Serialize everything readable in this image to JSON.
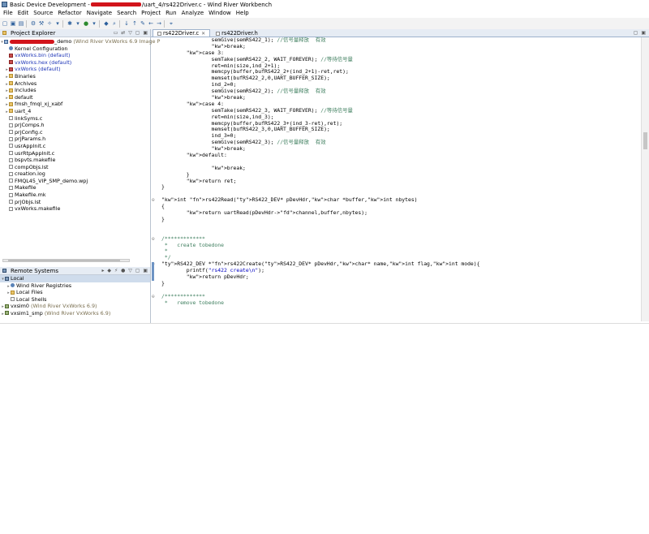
{
  "window": {
    "title_prefix": "Basic Device Development - ",
    "title_suffix": "/uart_4/rs422Driver.c - Wind River Workbench"
  },
  "menu": [
    "File",
    "Edit",
    "Source",
    "Refactor",
    "Navigate",
    "Search",
    "Project",
    "Run",
    "Analyze",
    "Window",
    "Help"
  ],
  "project_explorer": {
    "title": "Project Explorer",
    "project_name_suffix": "_demo",
    "project_suffix": "(Wind River VxWorks 6.9 Image P",
    "items": [
      {
        "label": "Kernel Configuration",
        "icon": "gear-icon",
        "style": "normal",
        "twisty": ""
      },
      {
        "label": "vxWorks.bin (default)",
        "icon": "binary-icon",
        "style": "blue",
        "twisty": ""
      },
      {
        "label": "vxWorks.hex (default)",
        "icon": "binary-icon",
        "style": "blue",
        "twisty": ""
      },
      {
        "label": "vxWorks (default)",
        "icon": "binary-icon",
        "style": "blue",
        "twisty": "▸"
      },
      {
        "label": "Binaries",
        "icon": "folder-icon",
        "style": "normal",
        "twisty": "▸"
      },
      {
        "label": "Archives",
        "icon": "folder-icon",
        "style": "normal",
        "twisty": "▸"
      },
      {
        "label": "Includes",
        "icon": "folder-icon",
        "style": "normal",
        "twisty": "▸"
      },
      {
        "label": "default",
        "icon": "folder-icon",
        "style": "normal",
        "twisty": "▸"
      },
      {
        "label": "fmsh_fmql_xj_xabf",
        "icon": "folder-icon",
        "style": "normal",
        "twisty": "▸"
      },
      {
        "label": "uart_4",
        "icon": "folder-icon",
        "style": "normal",
        "twisty": "▸"
      },
      {
        "label": "linkSyms.c",
        "icon": "file-icon",
        "style": "normal",
        "twisty": ""
      },
      {
        "label": "prjComps.h",
        "icon": "file-icon",
        "style": "normal",
        "twisty": ""
      },
      {
        "label": "prjConfig.c",
        "icon": "file-icon",
        "style": "normal",
        "twisty": ""
      },
      {
        "label": "prjParams.h",
        "icon": "file-icon",
        "style": "normal",
        "twisty": ""
      },
      {
        "label": "usrAppInit.c",
        "icon": "file-icon",
        "style": "normal",
        "twisty": ""
      },
      {
        "label": "usrRtpAppInit.c",
        "icon": "file-icon",
        "style": "normal",
        "twisty": ""
      },
      {
        "label": "bspvts.makefile",
        "icon": "file-icon",
        "style": "normal",
        "twisty": ""
      },
      {
        "label": "compObjs.lst",
        "icon": "file-icon",
        "style": "normal",
        "twisty": ""
      },
      {
        "label": "creation.log",
        "icon": "file-icon",
        "style": "normal",
        "twisty": ""
      },
      {
        "label": "FMQL45_VIP_SMP_demo.wpj",
        "icon": "file-icon",
        "style": "normal",
        "twisty": ""
      },
      {
        "label": "Makefile",
        "icon": "file-icon",
        "style": "normal",
        "twisty": ""
      },
      {
        "label": "Makefile.mk",
        "icon": "file-icon",
        "style": "normal",
        "twisty": ""
      },
      {
        "label": "prjObjs.lst",
        "icon": "file-icon",
        "style": "normal",
        "twisty": ""
      },
      {
        "label": "vxWorks.makefile",
        "icon": "file-icon",
        "style": "normal",
        "twisty": ""
      }
    ]
  },
  "remote_systems": {
    "title": "Remote Systems",
    "items": [
      {
        "label": "Local",
        "indent": 0,
        "twisty": "▾",
        "icon": "host-icon",
        "extra": ""
      },
      {
        "label": "Wind River Registries",
        "indent": 1,
        "twisty": "▸",
        "icon": "registry-icon",
        "extra": ""
      },
      {
        "label": "Local Files",
        "indent": 1,
        "twisty": "▸",
        "icon": "files-icon",
        "extra": ""
      },
      {
        "label": "Local Shells",
        "indent": 1,
        "twisty": "",
        "icon": "shell-icon",
        "extra": ""
      },
      {
        "label": "vxsim0",
        "indent": 0,
        "twisty": "▸",
        "icon": "target-icon",
        "extra": "(Wind River VxWorks 6.9)"
      },
      {
        "label": "vxsim1_smp",
        "indent": 0,
        "twisty": "▸",
        "icon": "target-icon",
        "extra": "(Wind River VxWorks 6.9)"
      }
    ]
  },
  "editor": {
    "tabs": [
      {
        "label": "rs422Driver.c",
        "active": true
      },
      {
        "label": "rs422Driver.h",
        "active": false
      }
    ],
    "lines": [
      "                semGive(semRS422_1); //信号量释放  有效",
      "                break;",
      "        case 3:",
      "                semTake(semRS422_2, WAIT_FOREVER); //等待信号量",
      "                ret=min(size,ind_2+1);",
      "                memcpy(buffer,bufRS422_2+(ind_2+1)-ret,ret);",
      "                memset(bufRS422_2,0,UART_BUFFER_SIZE);",
      "                ind_2=0;",
      "                semGive(semRS422_2); //信号量释放  有效",
      "                break;",
      "        case 4:",
      "                semTake(semRS422_3, WAIT_FOREVER); //等待信号量",
      "                ret=min(size,ind_3);",
      "                memcpy(buffer,bufRS422_3+(ind_3-ret),ret);",
      "                memset(bufRS422_3,0,UART_BUFFER_SIZE);",
      "                ind_3=0;",
      "                semGive(semRS422_3); //信号量释放  有效",
      "                break;",
      "        default:",
      "",
      "                break;",
      "        }",
      "        return ret;",
      "}",
      "",
      "int rs422Read(RS422_DEV* pDevHdr,char *buffer,int nbytes)",
      "{",
      "        return uartRead(pDevHdr->channel,buffer,nbytes);",
      "}",
      "",
      "",
      "/*************",
      " *   create tobedone",
      " *",
      " */",
      "RS422_DEV *rs422Create(RS422_DEV* pDevHdr,char* name,int flag,int mode){",
      "        printf(\"rs422 create\\n\");",
      "        return pDevHdr;",
      "}",
      "",
      "/*************",
      " *   remove tobedone"
    ]
  }
}
